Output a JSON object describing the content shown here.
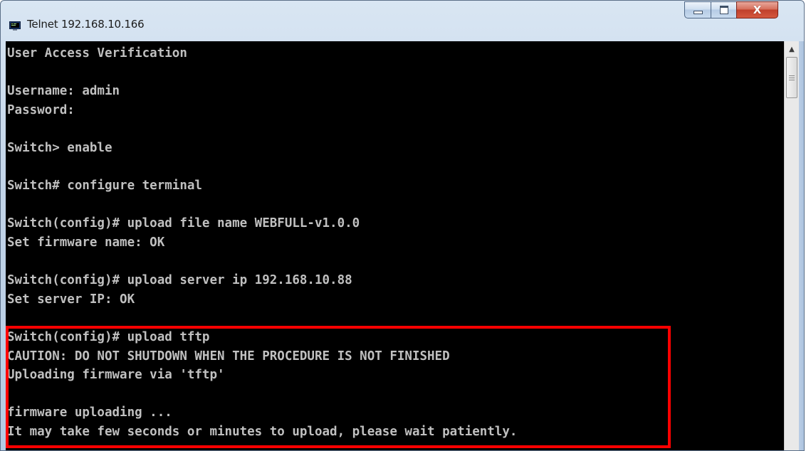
{
  "window": {
    "title": "Telnet 192.168.10.166",
    "icon": "telnet-terminal-icon",
    "controls": {
      "minimize_icon": "minimize-icon",
      "maximize_icon": "maximize-icon",
      "close_label": "X"
    }
  },
  "terminal": {
    "lines": [
      "User Access Verification",
      "",
      "Username: admin",
      "Password:",
      "",
      "Switch> enable",
      "",
      "Switch# configure terminal",
      "",
      "Switch(config)# upload file name WEBFULL-v1.0.0",
      "Set firmware name: OK",
      "",
      "Switch(config)# upload server ip 192.168.10.88",
      "Set server IP: OK",
      "",
      "Switch(config)# upload tftp",
      "CAUTION: DO NOT SHUTDOWN WHEN THE PROCEDURE IS NOT FINISHED",
      "Uploading firmware via 'tftp'",
      "",
      "firmware uploading ...",
      "It may take few seconds or minutes to upload, please wait patiently."
    ]
  },
  "colors": {
    "terminal_bg": "#000000",
    "terminal_text": "#c0c0c0",
    "highlight_border": "#ff0000"
  }
}
